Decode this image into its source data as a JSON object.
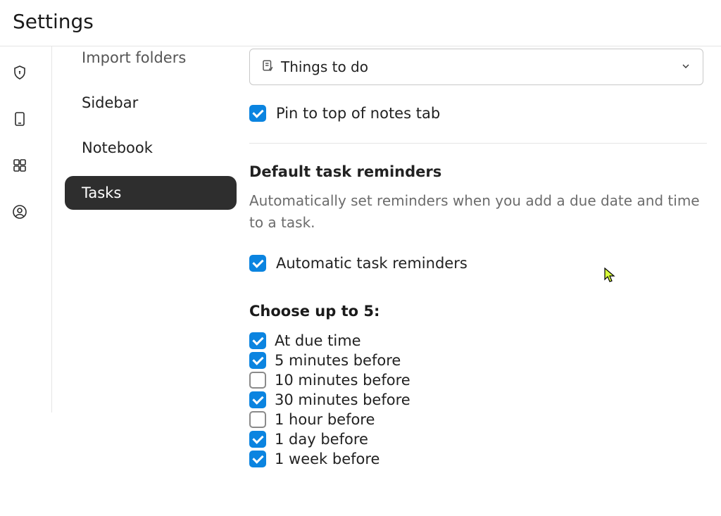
{
  "header": {
    "title": "Settings"
  },
  "subnav": {
    "items": [
      {
        "label": "Import folders",
        "active": false,
        "cut": true
      },
      {
        "label": "Sidebar",
        "active": false
      },
      {
        "label": "Notebook",
        "active": false
      },
      {
        "label": "Tasks",
        "active": true
      }
    ]
  },
  "select": {
    "value": "Things to do"
  },
  "pin_checkbox": {
    "label": "Pin to top of notes tab",
    "checked": true
  },
  "reminders_section": {
    "title": "Default task reminders",
    "description": "Automatically set reminders when you add a due date and time to a task.",
    "auto_label": "Automatic task reminders",
    "auto_checked": true,
    "choose_title": "Choose up to 5:",
    "options": [
      {
        "label": "At due time",
        "checked": true
      },
      {
        "label": "5 minutes before",
        "checked": true
      },
      {
        "label": "10 minutes before",
        "checked": false
      },
      {
        "label": "30 minutes before",
        "checked": true
      },
      {
        "label": "1 hour before",
        "checked": false
      },
      {
        "label": "1 day before",
        "checked": true
      },
      {
        "label": "1 week before",
        "checked": true
      }
    ]
  }
}
